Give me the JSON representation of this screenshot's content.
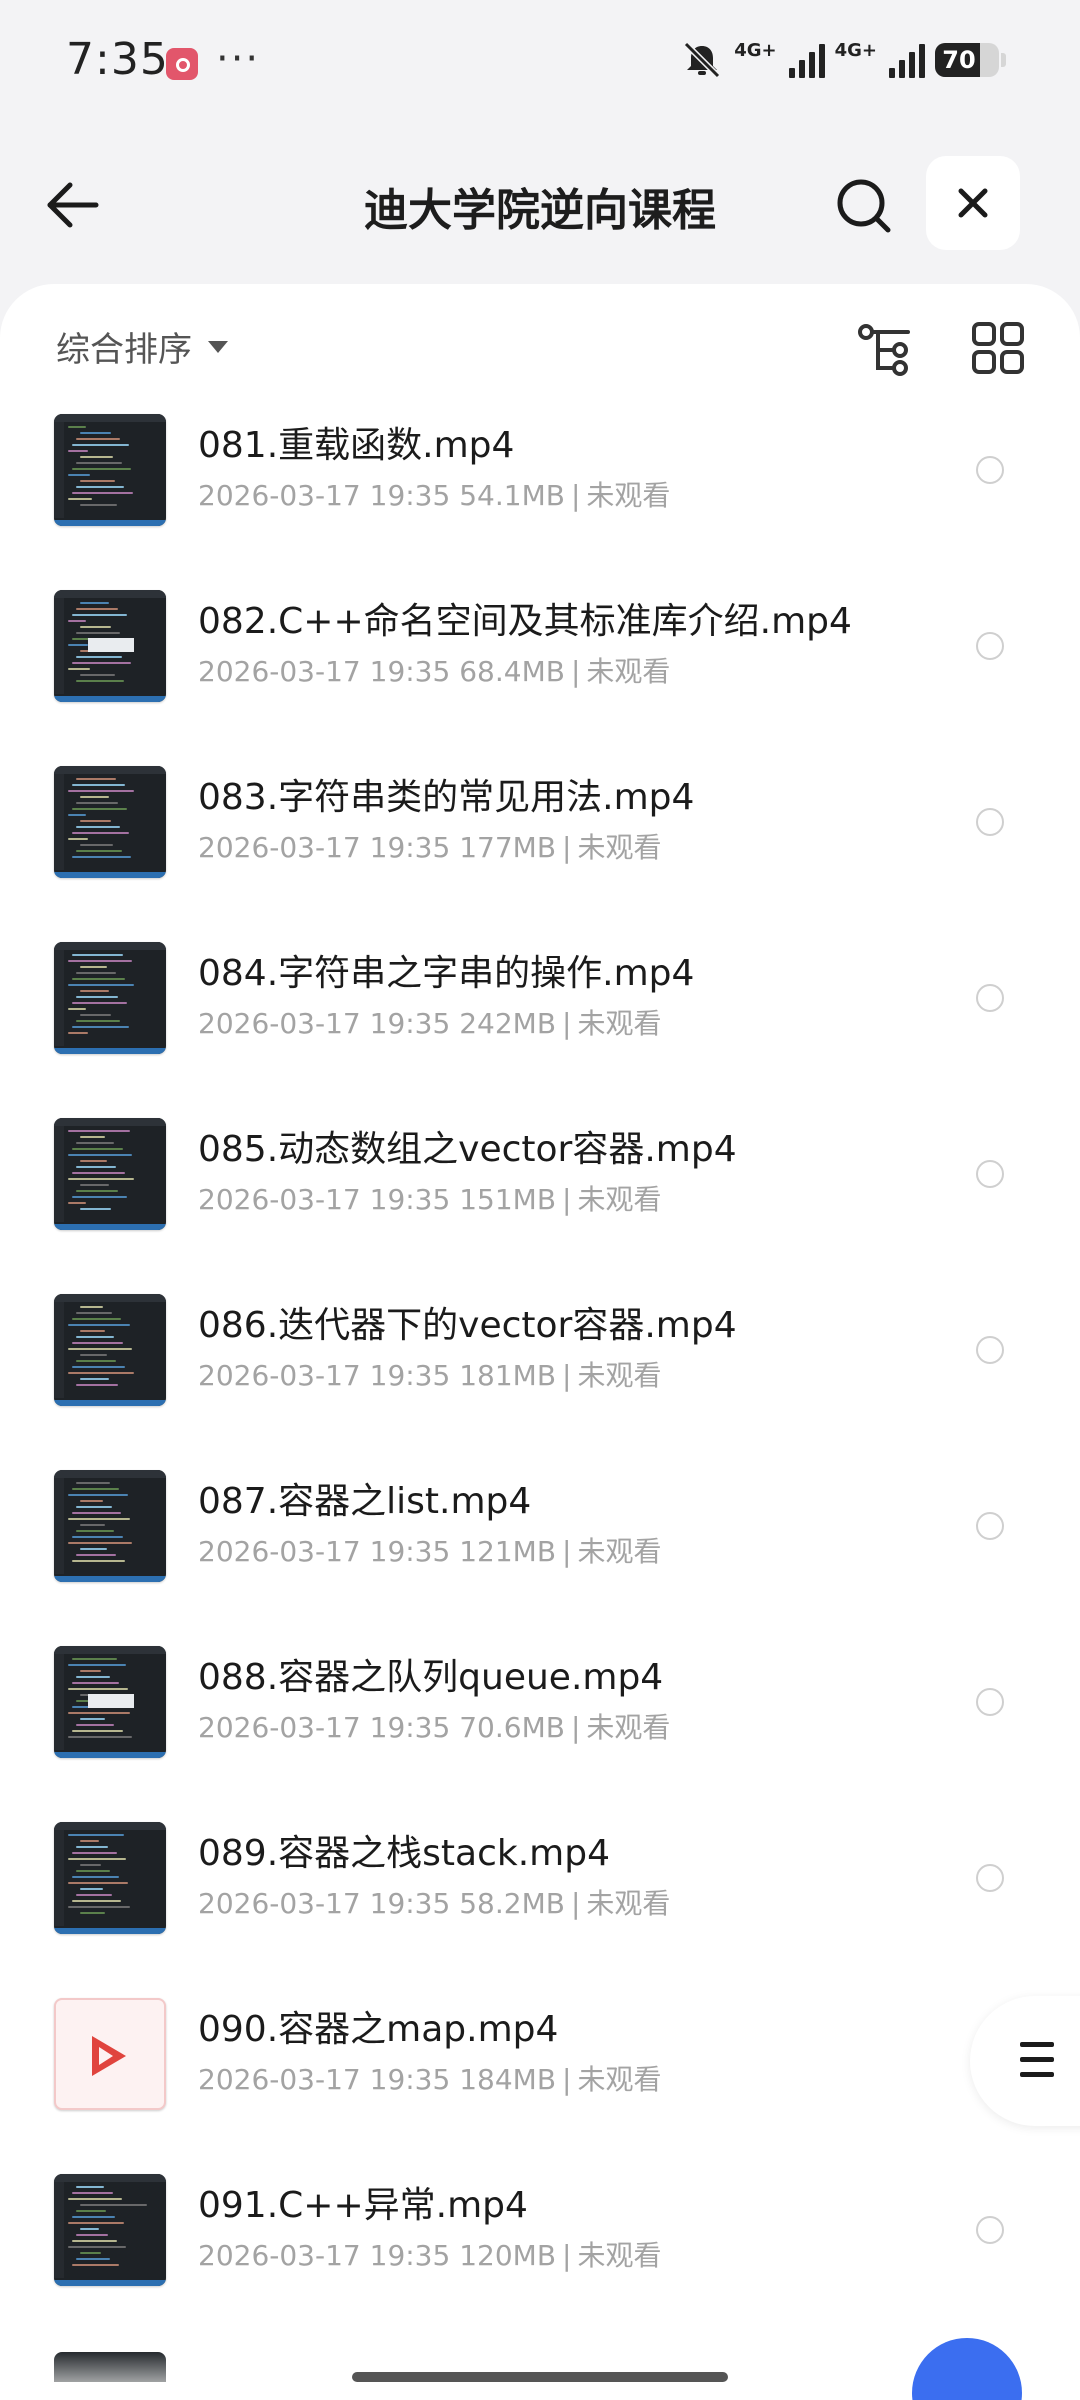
{
  "status_bar": {
    "time": "7:35",
    "more": "···",
    "network1": "4G+",
    "network2": "4G+",
    "battery": "70",
    "battery_level": 0.7
  },
  "header": {
    "title": "迪大学院逆向课程"
  },
  "sort": {
    "label": "综合排序"
  },
  "files": [
    {
      "name": "081.重载函数.mp4",
      "date": "2026-03-17 19:35",
      "size": "54.1MB",
      "status": "未观看",
      "thumb": "code"
    },
    {
      "name": "082.C++命名空间及其标准库介绍.mp4",
      "date": "2026-03-17 19:35",
      "size": "68.4MB",
      "status": "未观看",
      "thumb": "code-dialog"
    },
    {
      "name": "083.字符串类的常见用法.mp4",
      "date": "2026-03-17 19:35",
      "size": "177MB",
      "status": "未观看",
      "thumb": "code"
    },
    {
      "name": "084.字符串之字串的操作.mp4",
      "date": "2026-03-17 19:35",
      "size": "242MB",
      "status": "未观看",
      "thumb": "code"
    },
    {
      "name": "085.动态数组之vector容器.mp4",
      "date": "2026-03-17 19:35",
      "size": "151MB",
      "status": "未观看",
      "thumb": "code"
    },
    {
      "name": "086.迭代器下的vector容器.mp4",
      "date": "2026-03-17 19:35",
      "size": "181MB",
      "status": "未观看",
      "thumb": "code"
    },
    {
      "name": "087.容器之list.mp4",
      "date": "2026-03-17 19:35",
      "size": "121MB",
      "status": "未观看",
      "thumb": "code"
    },
    {
      "name": "088.容器之队列queue.mp4",
      "date": "2026-03-17 19:35",
      "size": "70.6MB",
      "status": "未观看",
      "thumb": "code-dialog"
    },
    {
      "name": "089.容器之栈stack.mp4",
      "date": "2026-03-17 19:35",
      "size": "58.2MB",
      "status": "未观看",
      "thumb": "code"
    },
    {
      "name": "090.容器之map.mp4",
      "date": "2026-03-17 19:35",
      "size": "184MB",
      "status": "未观看",
      "thumb": "video"
    },
    {
      "name": "091.C++异常.mp4",
      "date": "2026-03-17 19:35",
      "size": "120MB",
      "status": "未观看",
      "thumb": "code"
    }
  ],
  "meta_separator": "|",
  "icons": {
    "back": "arrow-left-icon",
    "search": "search-icon",
    "close": "close-icon",
    "tree": "tree-view-icon",
    "grid": "grid-view-icon",
    "menu": "menu-icon",
    "notify_off": "bell-off-icon"
  },
  "colors": {
    "background": "#f3f3f5",
    "card": "#ffffff",
    "title": "#1d1d1d",
    "meta": "#a3a3a3",
    "video_icon": "#e0443e",
    "fab": "#3b6ef0"
  }
}
